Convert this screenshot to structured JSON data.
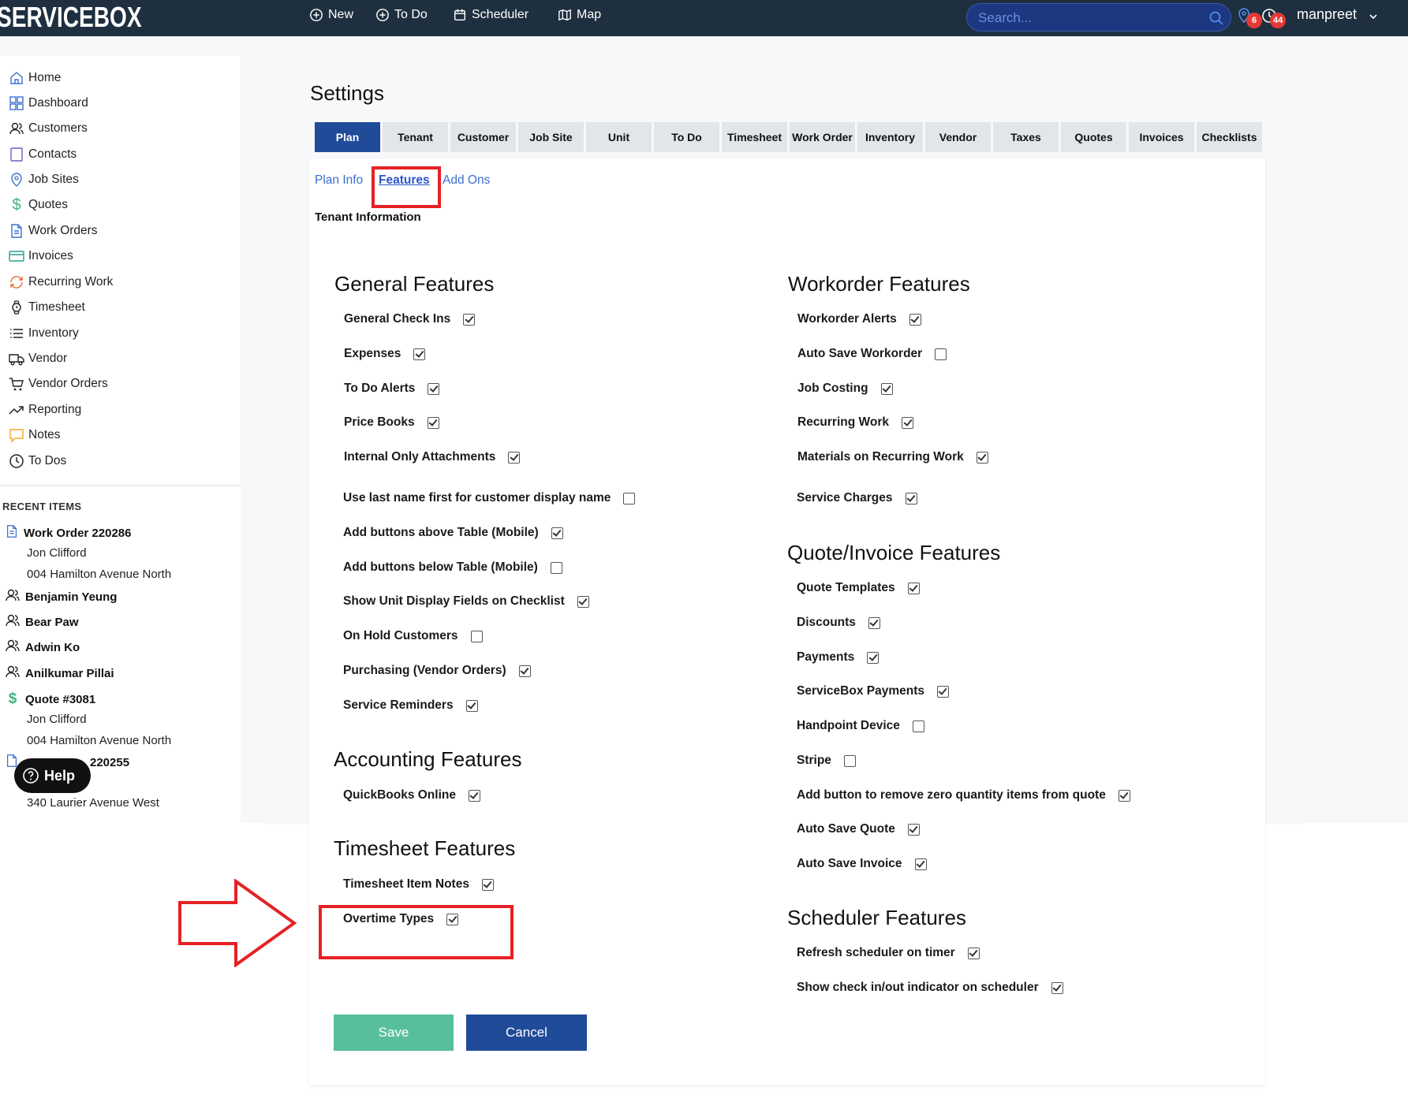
{
  "topbar": {
    "brand": "SERVICEBOX",
    "nav": [
      {
        "label": "New",
        "icon": "plus-circle-icon"
      },
      {
        "label": "To Do",
        "icon": "plus-circle-icon"
      },
      {
        "label": "Scheduler",
        "icon": "calendar-icon"
      },
      {
        "label": "Map",
        "icon": "map-icon"
      }
    ],
    "search_placeholder": "Search...",
    "location_badge": "6",
    "clock_badge": "44",
    "user": "manpreet"
  },
  "sidebar": {
    "items": [
      {
        "label": "Home",
        "icon": "home-icon"
      },
      {
        "label": "Dashboard",
        "icon": "dashboard-icon"
      },
      {
        "label": "Customers",
        "icon": "customers-icon"
      },
      {
        "label": "Contacts",
        "icon": "contacts-icon"
      },
      {
        "label": "Job Sites",
        "icon": "location-pin-icon"
      },
      {
        "label": "Quotes",
        "icon": "dollar-icon"
      },
      {
        "label": "Work Orders",
        "icon": "document-icon"
      },
      {
        "label": "Invoices",
        "icon": "credit-card-icon"
      },
      {
        "label": "Recurring Work",
        "icon": "refresh-icon"
      },
      {
        "label": "Timesheet",
        "icon": "watch-icon"
      },
      {
        "label": "Inventory",
        "icon": "list-icon"
      },
      {
        "label": "Vendor",
        "icon": "truck-icon"
      },
      {
        "label": "Vendor Orders",
        "icon": "cart-icon"
      },
      {
        "label": "Reporting",
        "icon": "trending-icon"
      },
      {
        "label": "Notes",
        "icon": "note-icon"
      },
      {
        "label": "To Dos",
        "icon": "clock-icon"
      }
    ]
  },
  "recent": {
    "title": "RECENT ITEMS",
    "items": [
      {
        "label": "Work Order 220286",
        "icon": "document-icon",
        "sub": [
          "Jon Clifford",
          "004 Hamilton Avenue North"
        ]
      },
      {
        "label": "Benjamin Yeung",
        "icon": "customers-icon",
        "sub": []
      },
      {
        "label": "Bear Paw",
        "icon": "customers-icon",
        "sub": []
      },
      {
        "label": "Adwin Ko",
        "icon": "customers-icon",
        "sub": []
      },
      {
        "label": "Anilkumar Pillai",
        "icon": "customers-icon",
        "sub": []
      },
      {
        "label": "Quote #3081",
        "icon": "dollar-icon",
        "sub": [
          "Jon Clifford",
          "004 Hamilton Avenue North"
        ]
      },
      {
        "label": "220255",
        "icon": "document-icon",
        "sub": [
          "340 Laurier Avenue West"
        ]
      }
    ],
    "help": "Help"
  },
  "page": {
    "title": "Settings",
    "tabs": [
      "Plan",
      "Tenant",
      "Customer",
      "Job Site",
      "Unit",
      "To Do",
      "Timesheet",
      "Work Order",
      "Inventory",
      "Vendor",
      "Taxes",
      "Quotes",
      "Invoices",
      "Checklists"
    ],
    "active_tab": "Plan",
    "subtabs": [
      "Plan Info",
      "Features",
      "Add Ons"
    ],
    "active_subtab": "Features",
    "tenant_info": "Tenant Information"
  },
  "general": {
    "title": "General Features",
    "items": [
      {
        "label": "General Check Ins",
        "checked": true
      },
      {
        "label": "Expenses",
        "checked": true
      },
      {
        "label": "To Do Alerts",
        "checked": true
      },
      {
        "label": "Price Books",
        "checked": true
      },
      {
        "label": "Internal Only Attachments",
        "checked": true
      },
      {
        "label": "Use last name first for customer display name",
        "checked": false
      },
      {
        "label": "Add buttons above Table (Mobile)",
        "checked": true
      },
      {
        "label": "Add buttons below Table (Mobile)",
        "checked": false
      },
      {
        "label": "Show Unit Display Fields on Checklist",
        "checked": true
      },
      {
        "label": "On Hold Customers",
        "checked": false
      },
      {
        "label": "Purchasing (Vendor Orders)",
        "checked": true
      },
      {
        "label": "Service Reminders",
        "checked": true
      }
    ]
  },
  "accounting": {
    "title": "Accounting Features",
    "items": [
      {
        "label": "QuickBooks Online",
        "checked": true
      }
    ]
  },
  "timesheet": {
    "title": "Timesheet Features",
    "items": [
      {
        "label": "Timesheet Item Notes",
        "checked": true
      },
      {
        "label": "Overtime Types",
        "checked": true
      }
    ]
  },
  "workorder": {
    "title": "Workorder Features",
    "items": [
      {
        "label": "Workorder Alerts",
        "checked": true
      },
      {
        "label": "Auto Save Workorder",
        "checked": false
      },
      {
        "label": "Job Costing",
        "checked": true
      },
      {
        "label": "Recurring Work",
        "checked": true
      },
      {
        "label": "Materials on Recurring Work",
        "checked": true
      },
      {
        "label": "Service Charges",
        "checked": true
      }
    ]
  },
  "quote_invoice": {
    "title": "Quote/Invoice Features",
    "items": [
      {
        "label": "Quote Templates",
        "checked": true
      },
      {
        "label": "Discounts",
        "checked": true
      },
      {
        "label": "Payments",
        "checked": true
      },
      {
        "label": "ServiceBox Payments",
        "checked": true
      },
      {
        "label": "Handpoint Device",
        "checked": false
      },
      {
        "label": "Stripe",
        "checked": false
      },
      {
        "label": "Add button to remove zero quantity items from quote",
        "checked": true
      },
      {
        "label": "Auto Save Quote",
        "checked": true
      },
      {
        "label": "Auto Save Invoice",
        "checked": true
      }
    ]
  },
  "scheduler": {
    "title": "Scheduler Features",
    "items": [
      {
        "label": "Refresh scheduler on timer",
        "checked": true
      },
      {
        "label": "Show check in/out indicator on scheduler",
        "checked": true
      }
    ]
  },
  "actions": {
    "save": "Save",
    "cancel": "Cancel"
  },
  "colors": {
    "topbar": "#1e2f3f",
    "primary": "#1f4b99",
    "save": "#57bf9c",
    "highlight": "#e52125",
    "link": "#3b6fd1"
  }
}
